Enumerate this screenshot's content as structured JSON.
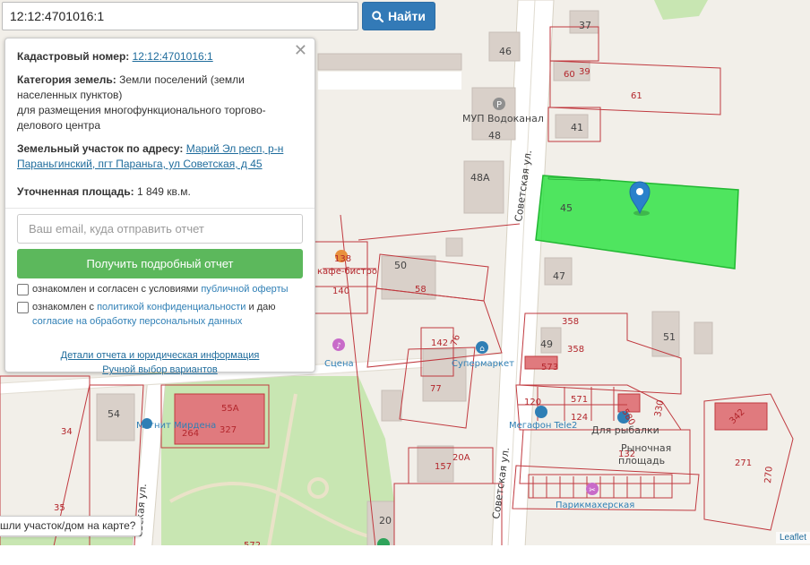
{
  "search": {
    "value": "12:12:4701016:1",
    "button_label": "Найти"
  },
  "panel": {
    "cad_label": "Кадастровый номер:",
    "cad_value": "12:12:4701016:1",
    "cat_label": "Категория земель:",
    "cat_value": "Земли поселений (земли населенных пунктов)",
    "purpose": "для размещения многофункционального торгово-делового центра",
    "addr_label": "Земельный участок по адресу:",
    "addr_value": "Марий Эл респ, р-н Параньгинский, пгт Параньга, ул Советская, д 45",
    "area_label": "Уточненная площадь:",
    "area_value": "1 849 кв.м.",
    "email_placeholder": "Ваш email, куда отправить отчет",
    "report_button": "Получить подробный отчет",
    "consent1_pre": "ознакомлен и согласен с условиями",
    "consent1_link": "публичной оферты",
    "consent2_pre": "ознакомлен с",
    "consent2_link": "политикой конфиденциальности",
    "consent2_mid": "и даю",
    "consent2_link2": "согласие на обработку персональных данных",
    "details_link": "Детали отчета и юридическая информация",
    "manual_link": "Ручной выбор вариантов"
  },
  "found_prompt": "шли участок/дом на карте?",
  "attribution": "Leaflet",
  "map": {
    "streets": [
      "Советская ул.",
      "Советская ул.",
      "евская ул."
    ],
    "buildings": [
      "37",
      "46",
      "60",
      "39",
      "61",
      "41",
      "48",
      "48А",
      "45",
      "47",
      "49",
      "51",
      "50",
      "58",
      "76",
      "77",
      "54",
      "55А",
      "264",
      "327",
      "157",
      "20",
      "120",
      "571",
      "124",
      "580",
      "330",
      "132",
      "271",
      "342",
      "270",
      "34",
      "35",
      "142",
      "140",
      "138",
      "358",
      "358",
      "573",
      "20А",
      "572"
    ],
    "poi": [
      "МУП Водоканал",
      "Сцена",
      "Супермаркет",
      "Магнит Мирдена",
      "Мегафон Tele2",
      "Для рыбалки",
      "Рыночная площадь",
      "Парикмахерская",
      "кафе-бистро"
    ],
    "highlight_color": "#33e346",
    "plot_line_color": "#c0393f",
    "marker_color": "#2a81cb"
  }
}
